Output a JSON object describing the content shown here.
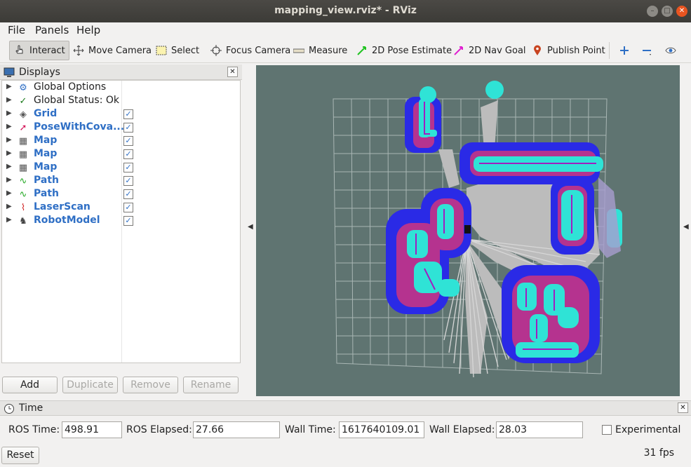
{
  "window": {
    "title": "mapping_view.rviz* - RViz"
  },
  "menu": [
    "File",
    "Panels",
    "Help"
  ],
  "toolbar": {
    "tools": [
      {
        "label": "Interact",
        "icon": "hand-pointer-icon",
        "active": true
      },
      {
        "label": "Move Camera",
        "icon": "move-arrows-icon"
      },
      {
        "label": "Select",
        "icon": "select-box-icon"
      },
      {
        "label": "Focus Camera",
        "icon": "focus-target-icon"
      },
      {
        "label": "Measure",
        "icon": "ruler-icon"
      },
      {
        "label": "2D Pose Estimate",
        "icon": "green-arrow-icon"
      },
      {
        "label": "2D Nav Goal",
        "icon": "magenta-arrow-icon"
      },
      {
        "label": "Publish Point",
        "icon": "map-pin-icon"
      }
    ]
  },
  "displays": {
    "title": "Displays",
    "items": [
      {
        "name": "Global Options",
        "icon": "gear-icon",
        "checkable": false,
        "highlight": false
      },
      {
        "name": "Global Status: Ok",
        "icon": "checkmark-icon",
        "checkable": false,
        "highlight": false
      },
      {
        "name": "Grid",
        "icon": "grid-icon",
        "checkable": true,
        "highlight": true
      },
      {
        "name": "PoseWithCova...",
        "icon": "pose-icon",
        "checkable": true,
        "highlight": true
      },
      {
        "name": "Map",
        "icon": "map-icon",
        "checkable": true,
        "highlight": true
      },
      {
        "name": "Map",
        "icon": "map-icon",
        "checkable": true,
        "highlight": true
      },
      {
        "name": "Map",
        "icon": "map-icon",
        "checkable": true,
        "highlight": true
      },
      {
        "name": "Path",
        "icon": "path-icon",
        "checkable": true,
        "highlight": true
      },
      {
        "name": "Path",
        "icon": "path-icon",
        "checkable": true,
        "highlight": true
      },
      {
        "name": "LaserScan",
        "icon": "laserscan-icon",
        "checkable": true,
        "highlight": true
      },
      {
        "name": "RobotModel",
        "icon": "robot-icon",
        "checkable": true,
        "highlight": true
      }
    ],
    "buttons": {
      "add": "Add",
      "duplicate": "Duplicate",
      "remove": "Remove",
      "rename": "Rename"
    }
  },
  "time": {
    "title": "Time",
    "ros_time_label": "ROS Time:",
    "ros_time": "498.91",
    "ros_elapsed_label": "ROS Elapsed:",
    "ros_elapsed": "27.66",
    "wall_time_label": "Wall Time:",
    "wall_time": "1617640109.01",
    "wall_elapsed_label": "Wall Elapsed:",
    "wall_elapsed": "28.03",
    "experimental_label": "Experimental",
    "reset_label": "Reset",
    "fps": "31 fps"
  },
  "colors": {
    "viewport_bg": "#5f7471",
    "costmap_blue": "#2a2ae6",
    "costmap_cyan": "#2fe3d6",
    "free_space": "#bcbcbc",
    "accent_link": "#2f6fc5"
  }
}
